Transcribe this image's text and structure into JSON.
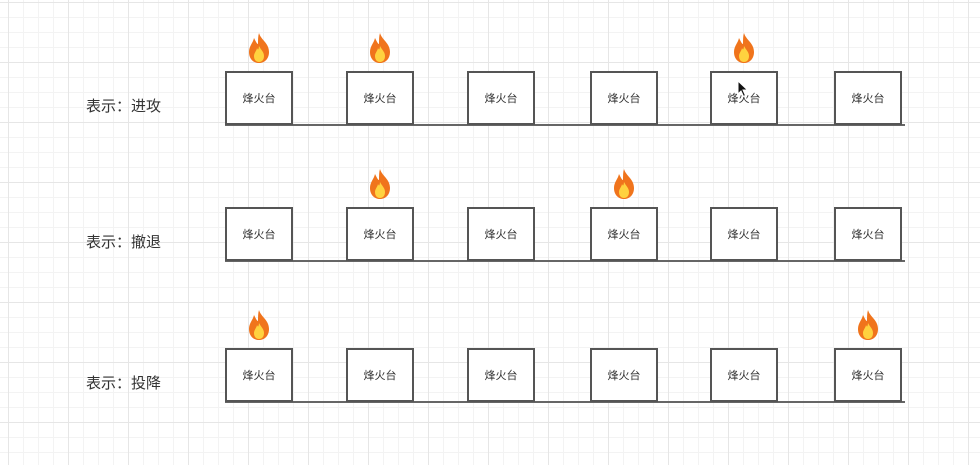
{
  "signal_tower_label": "烽火台",
  "rows": [
    {
      "label": "表示：进攻",
      "fires": [
        true,
        true,
        false,
        false,
        true,
        false
      ]
    },
    {
      "label": "表示：撤退",
      "fires": [
        false,
        true,
        false,
        true,
        false,
        false
      ]
    },
    {
      "label": "表示：投降",
      "fires": [
        true,
        false,
        false,
        false,
        false,
        true
      ]
    }
  ],
  "icons": {
    "fire": "fire-icon",
    "cursor": "mouse-pointer-icon"
  },
  "colors": {
    "box_border": "#555555",
    "line": "#666666",
    "flame_outer": "#f0741c",
    "flame_inner": "#ffd23f"
  }
}
